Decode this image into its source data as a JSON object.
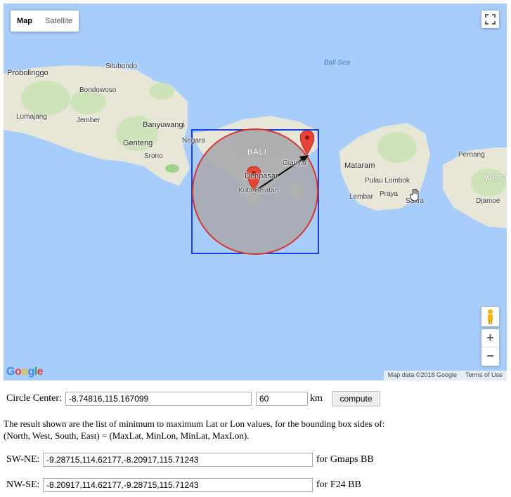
{
  "map": {
    "type_tabs": [
      {
        "label": "Map",
        "active": true
      },
      {
        "label": "Satellite",
        "active": false
      }
    ],
    "labels": {
      "probolinggo": "Probolinggo",
      "situbondo": "Situbondo",
      "bondowoso": "Bondowoso",
      "lumajang": "Lumajang",
      "jember": "Jember",
      "banyuwangi": "Banyuwangi",
      "genteng": "Genteng",
      "srono": "Srono",
      "negara": "Negara",
      "bali": "BALI",
      "gianyar": "Gianyar",
      "denpasar": "Denpasar",
      "kuta_selatan": "Kuta Selatan",
      "bali_sea": "Bali Sea",
      "mataram": "Mataram",
      "pulau_lombok": "Pulau Lombok",
      "lembar": "Lembar",
      "praya": "Praya",
      "sakra": "Sakra",
      "pernang": "Pernang",
      "west": "WEST",
      "dompu": "Djamoe"
    },
    "attribution": {
      "map_data": "Map data ©2018 Google",
      "terms": "Terms of Use"
    },
    "logo": "Google",
    "zoom_in": "+",
    "zoom_out": "−",
    "icons": {
      "fullscreen": "fullscreen-icon",
      "pegman": "pegman-icon",
      "marker": "marker-icon",
      "cursor": "hand-cursor-icon"
    },
    "colors": {
      "water": "#a6cdfb",
      "land": "#e8e6d6",
      "circle_stroke": "#d9342b",
      "box_stroke": "#1c3fe0",
      "marker": "#ea4335"
    }
  },
  "form": {
    "center_label": "Circle Center:",
    "center_value": "-8.74816,115.167099",
    "radius_value": "60",
    "unit_label": "km",
    "compute_label": "compute",
    "description_line1": "The result shown are the list of minimum to maximum Lat or Lon values, for the bounding box sides of:",
    "description_line2": "(North, West, South, East) = (MaxLat, MinLon, MinLat, MaxLon).",
    "swne_label": "SW-NE:",
    "swne_value": "-9.28715,114.62177,-8.20917,115.71243",
    "swne_suffix": "for Gmaps BB",
    "nwse_label": "NW-SE:",
    "nwse_value": "-8.20917,114.62177,-9.28715,115.71243",
    "nwse_suffix": "for F24 BB"
  }
}
